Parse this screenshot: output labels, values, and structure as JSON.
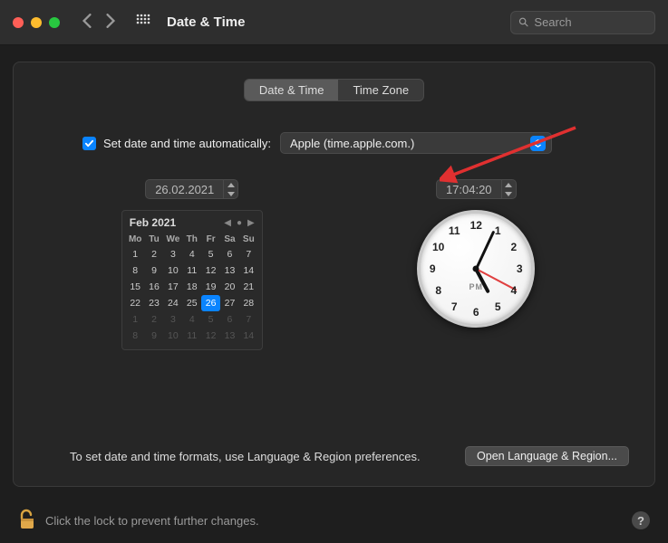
{
  "window": {
    "title": "Date & Time",
    "search_placeholder": "Search"
  },
  "tabs": [
    {
      "label": "Date & Time",
      "active": true
    },
    {
      "label": "Time Zone",
      "active": false
    }
  ],
  "auto": {
    "checked": true,
    "label": "Set date and time automatically:",
    "server": "Apple (time.apple.com.)"
  },
  "date_stepper": "26.02.2021",
  "time_stepper": "17:04:20",
  "calendar": {
    "title": "Feb 2021",
    "dow": [
      "Mo",
      "Tu",
      "We",
      "Th",
      "Fr",
      "Sa",
      "Su"
    ],
    "weeks": [
      [
        {
          "n": 1
        },
        {
          "n": 2
        },
        {
          "n": 3
        },
        {
          "n": 4
        },
        {
          "n": 5
        },
        {
          "n": 6
        },
        {
          "n": 7
        }
      ],
      [
        {
          "n": 8
        },
        {
          "n": 9
        },
        {
          "n": 10
        },
        {
          "n": 11
        },
        {
          "n": 12
        },
        {
          "n": 13
        },
        {
          "n": 14
        }
      ],
      [
        {
          "n": 15
        },
        {
          "n": 16
        },
        {
          "n": 17
        },
        {
          "n": 18
        },
        {
          "n": 19
        },
        {
          "n": 20
        },
        {
          "n": 21
        }
      ],
      [
        {
          "n": 22
        },
        {
          "n": 23
        },
        {
          "n": 24
        },
        {
          "n": 25
        },
        {
          "n": 26,
          "sel": true
        },
        {
          "n": 27
        },
        {
          "n": 28
        }
      ],
      [
        {
          "n": 1,
          "dim": true
        },
        {
          "n": 2,
          "dim": true
        },
        {
          "n": 3,
          "dim": true
        },
        {
          "n": 4,
          "dim": true
        },
        {
          "n": 5,
          "dim": true
        },
        {
          "n": 6,
          "dim": true
        },
        {
          "n": 7,
          "dim": true
        }
      ],
      [
        {
          "n": 8,
          "dim": true
        },
        {
          "n": 9,
          "dim": true
        },
        {
          "n": 10,
          "dim": true
        },
        {
          "n": 11,
          "dim": true
        },
        {
          "n": 12,
          "dim": true
        },
        {
          "n": 13,
          "dim": true
        },
        {
          "n": 14,
          "dim": true
        }
      ]
    ]
  },
  "clock": {
    "ampm": "PM",
    "hour_angle": 152,
    "minute_angle": 25,
    "second_angle": 118
  },
  "footer": {
    "hint": "To set date and time formats, use Language & Region preferences.",
    "button": "Open Language & Region..."
  },
  "lock": {
    "text": "Click the lock to prevent further changes.",
    "help": "?"
  },
  "colors": {
    "accent": "#0a84ff"
  }
}
